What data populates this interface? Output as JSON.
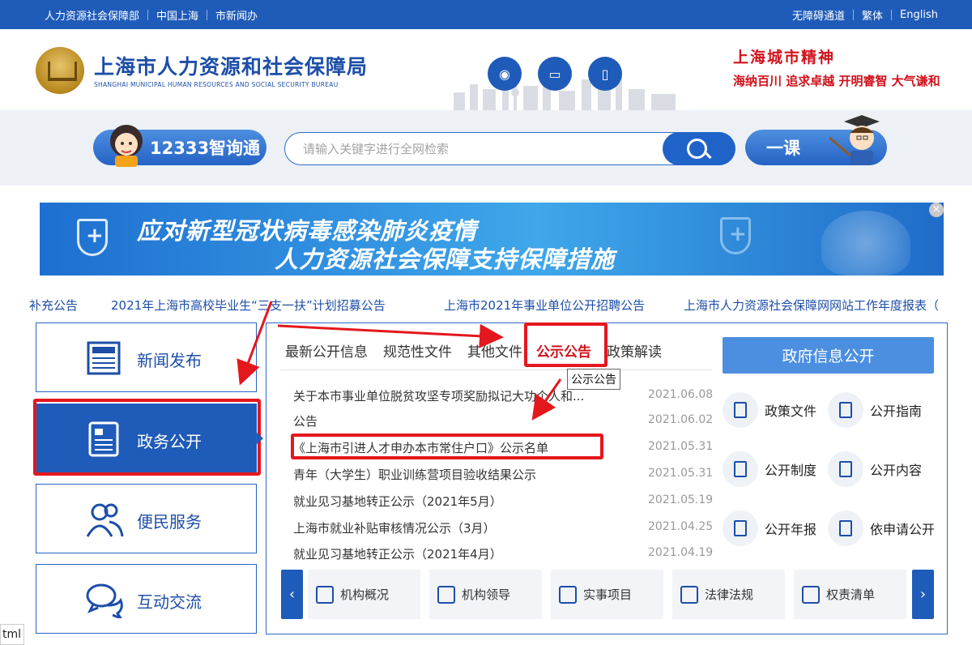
{
  "topbar": {
    "left": [
      "人力资源社会保障部",
      "中国上海",
      "市新闻办"
    ],
    "right": [
      "无障碍通道",
      "繁体",
      "English"
    ]
  },
  "header": {
    "title_cn": "上海市人力资源和社会保障局",
    "title_en": "SHANGHAI MUNICIPAL HUMAN RESOURCES AND SOCIAL SECURITY BUREAU",
    "spirit_title": "上海城市精神",
    "spirit_slogans": "海纳百川 追求卓越 开明睿智 大气谦和"
  },
  "search": {
    "assistant_label": "12333智询通",
    "placeholder": "请输入关键字进行全网检索",
    "course_label": "一课"
  },
  "banner": {
    "line1": "应对新型冠状病毒感染肺炎疫情",
    "line2": "人力资源社会保障支持保障措施",
    "close": "×"
  },
  "ticker": [
    "补充公告",
    "2021年上海市高校毕业生“三支一扶”计划招募公告",
    "上海市2021年事业单位公开招聘公告",
    "上海市人力资源社会保障网网站工作年度报表（"
  ],
  "nav": [
    {
      "label": "新闻发布"
    },
    {
      "label": "政务公开"
    },
    {
      "label": "便民服务"
    },
    {
      "label": "互动交流"
    }
  ],
  "tabs": [
    "最新公开信息",
    "规范性文件",
    "其他文件",
    "公示公告",
    "政策解读"
  ],
  "tooltip": "公示公告",
  "news": [
    {
      "title": "关于本市事业单位脱贫攻坚专项奖励拟记大功个人和...",
      "date": "2021.06.08"
    },
    {
      "title": "公告",
      "date": "2021.06.02"
    },
    {
      "title": "《上海市引进人才申办本市常住户口》公示名单",
      "date": "2021.05.31"
    },
    {
      "title": "青年（大学生）职业训练营项目验收结果公示",
      "date": "2021.05.31"
    },
    {
      "title": "就业见习基地转正公示（2021年5月）",
      "date": "2021.05.19"
    },
    {
      "title": "上海市就业补贴审核情况公示（3月）",
      "date": "2021.04.25"
    },
    {
      "title": "就业见习基地转正公示（2021年4月）",
      "date": "2021.04.19"
    }
  ],
  "gov": {
    "title": "政府信息公开",
    "items": [
      "政策文件",
      "公开指南",
      "公开制度",
      "公开内容",
      "公开年报",
      "依申请公开"
    ]
  },
  "bottom": [
    "机构概况",
    "机构领导",
    "实事项目",
    "法律法规",
    "权责清单"
  ],
  "side_tag": "tml",
  "colors": {
    "brand_blue": "#1f5bb8",
    "annotation_red": "#e4171d",
    "spirit_red": "#d0121b"
  }
}
